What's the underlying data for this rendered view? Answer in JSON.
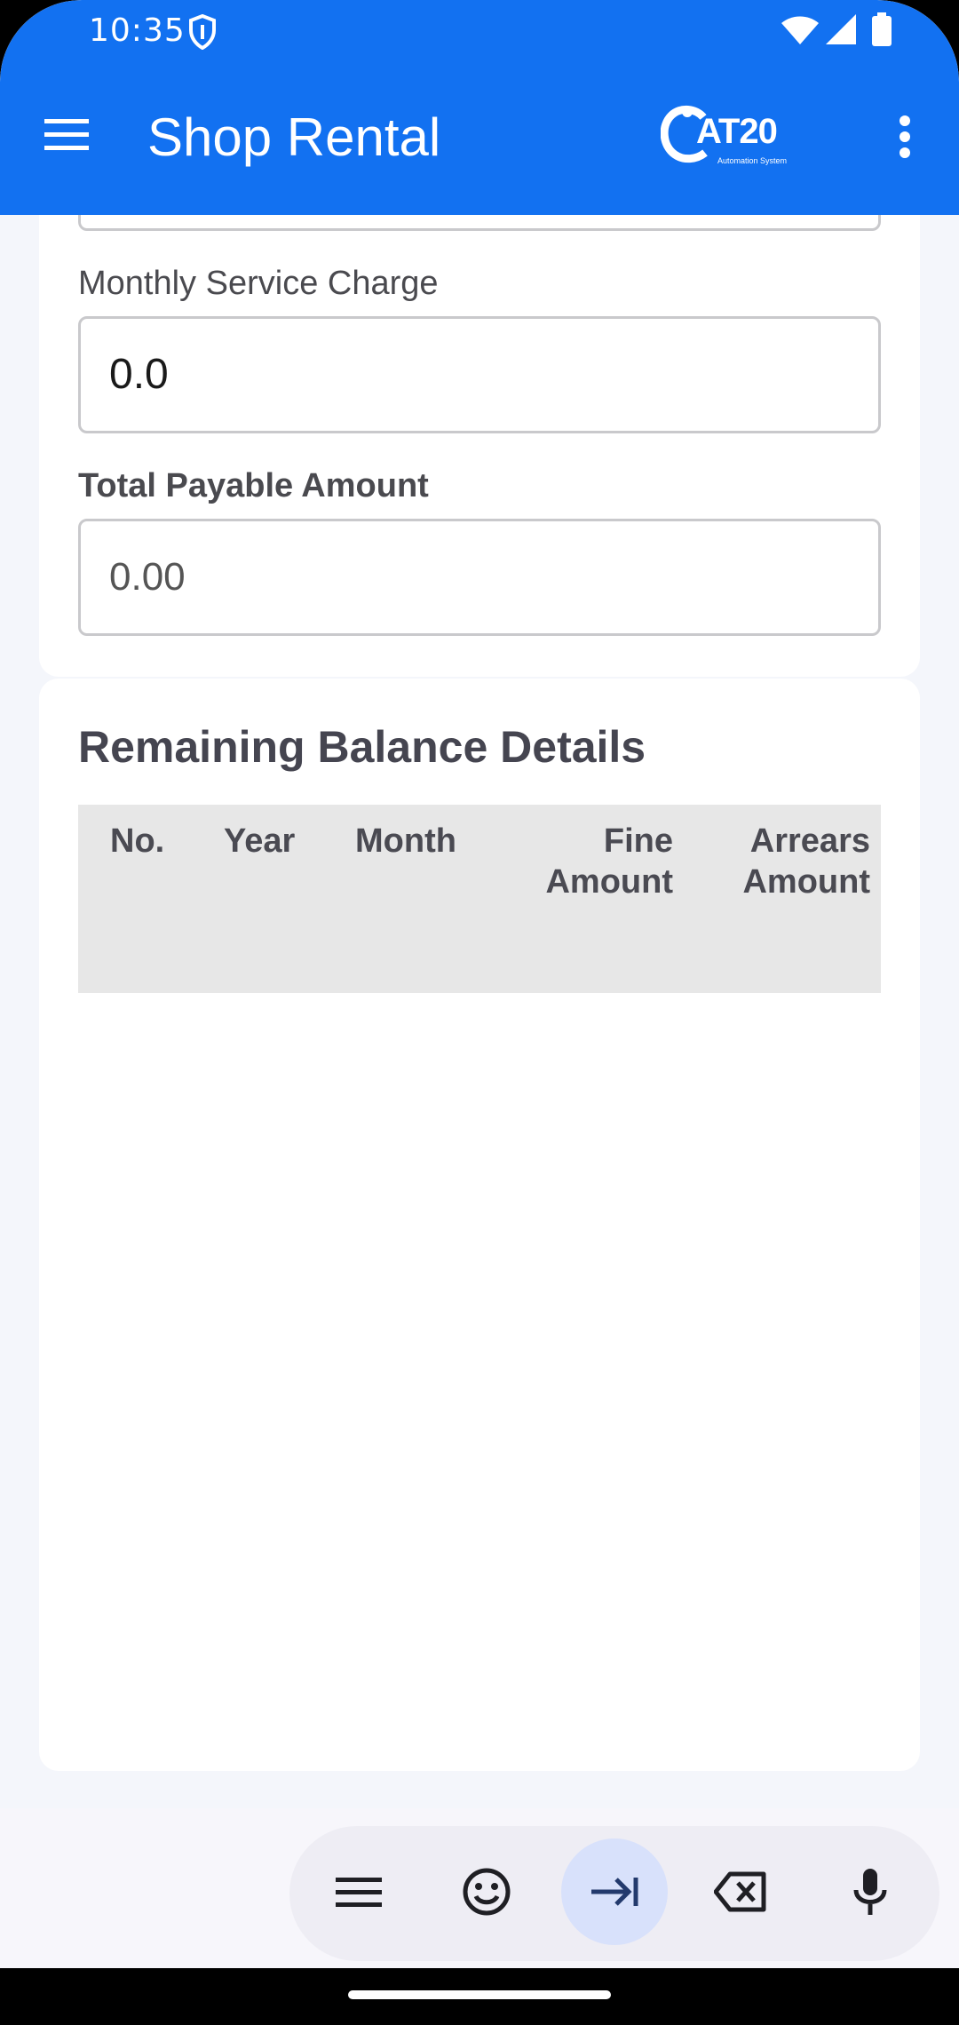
{
  "status_bar": {
    "time": "10:35",
    "icons": [
      "shield-icon",
      "wifi-icon",
      "signal-icon",
      "battery-icon"
    ]
  },
  "app_bar": {
    "title": "Shop Rental",
    "logo_text": "AT20",
    "logo_subtext": "Automation System",
    "color": "#1271f1"
  },
  "form": {
    "monthly_service_charge_label": "Monthly Service Charge",
    "monthly_service_charge_value": "0.0",
    "total_payable_label": "Total Payable Amount",
    "total_payable_value": "0.00"
  },
  "balance_section": {
    "title": "Remaining Balance Details",
    "columns": {
      "no": "No.",
      "year": "Year",
      "month": "Month",
      "fine_amount_line1": "Fine",
      "fine_amount_line2": "Amount",
      "arrears_amount_line1": "Arrears",
      "arrears_amount_line2": "Amount"
    },
    "rows": []
  },
  "keyboard_toolbar": {
    "buttons": [
      "menu-icon",
      "emoji-icon",
      "tab-icon",
      "backspace-icon",
      "mic-icon"
    ]
  }
}
